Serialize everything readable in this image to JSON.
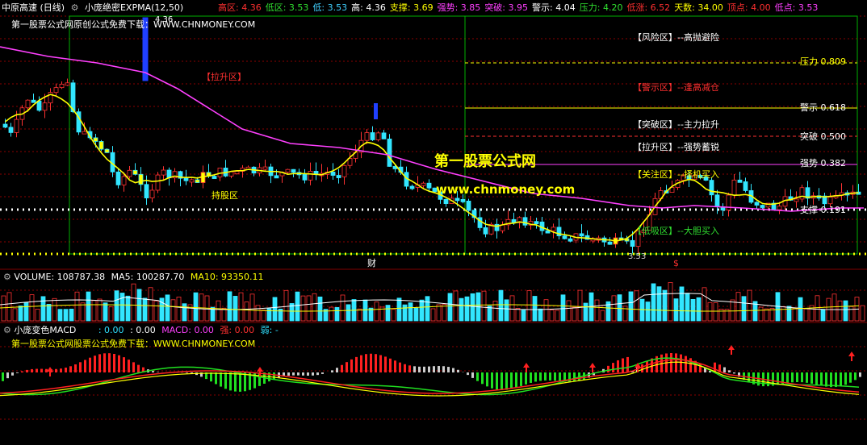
{
  "colors": {
    "up": "#ff3232",
    "down": "#32e6ff",
    "ma": "#ffff00",
    "expma": "#ff40ff",
    "grid": "#8b0000",
    "frame": "#00b000",
    "white": "#ffffff"
  },
  "header": {
    "stock": "中原高速 (日线)",
    "indicator": "小庞绝密EXPMA(12,50)",
    "items": [
      {
        "label": "高区:",
        "value": "4.36",
        "color": "#ff3030"
      },
      {
        "label": "低区:",
        "value": "3.53",
        "color": "#30e030"
      },
      {
        "label": "低:",
        "value": "3.53",
        "color": "#40d0ff"
      },
      {
        "label": "高:",
        "value": "4.36",
        "color": "#ffffff"
      },
      {
        "label": "支撑:",
        "value": "3.69",
        "color": "#ffff00"
      },
      {
        "label": "强势:",
        "value": "3.85",
        "color": "#ff40ff"
      },
      {
        "label": "突破:",
        "value": "3.95",
        "color": "#ff40ff"
      },
      {
        "label": "警示:",
        "value": "4.04",
        "color": "#ffffff"
      },
      {
        "label": "压力:",
        "value": "4.20",
        "color": "#30e030"
      },
      {
        "label": "低涨:",
        "value": "6.52",
        "color": "#ff3030"
      },
      {
        "label": "天数:",
        "value": "34.00",
        "color": "#ffff00"
      },
      {
        "label": "顶点:",
        "value": "4.00",
        "color": "#ff3030"
      },
      {
        "label": "低点:",
        "value": "3.53",
        "color": "#ff40ff"
      }
    ]
  },
  "main": {
    "banner": "第一股票公式网原创公式免费下载：WWW.CHNMONEY.COM",
    "high_mark": "4.36",
    "low_mark": "3.53",
    "zone_lift": "【拉升区】",
    "zone_hold": "持股区",
    "zones": [
      {
        "tag": "【风险区】",
        "desc": "--高抛避险",
        "tagcolor": "#ffffff",
        "desccolor": "#ffffff"
      },
      {
        "tag": "【警示区】",
        "desc": "--逢高减仓",
        "tagcolor": "#ff3030",
        "desccolor": "#ff3030"
      },
      {
        "tag": "【突破区】",
        "desc": "--主力拉升",
        "tagcolor": "#ffffff",
        "desccolor": "#ffffff"
      },
      {
        "tag": "【拉升区】",
        "desc": "--强势蓄锐",
        "tagcolor": "#ffffff",
        "desccolor": "#ffffff"
      },
      {
        "tag": "【关注区】",
        "desc": "--择机买入",
        "tagcolor": "#ffff00",
        "desccolor": "#ffff00"
      },
      {
        "tag": "【低吸区】",
        "desc": "--大胆买入",
        "tagcolor": "#30e030",
        "desccolor": "#30e030"
      }
    ],
    "levels": [
      {
        "label": "压力 0.809",
        "color": "#ffff00"
      },
      {
        "label": "警示 0.618",
        "color": "#ffffff"
      },
      {
        "label": "突破 0.500",
        "color": "#ffffff"
      },
      {
        "label": "强势 0.382",
        "color": "#ffffff"
      },
      {
        "label": "支撑 0.191",
        "color": "#ffffff"
      }
    ],
    "watermark_name": "第一股票公式网",
    "watermark_url": "www.chnmoney.com",
    "marker_cai": "财",
    "marker_dollar": "$"
  },
  "volume": {
    "label": "VOLUME: 108787.38",
    "ma5": "MA5: 100287.70",
    "ma10": "MA10: 93350.11"
  },
  "macd": {
    "name": "小庞变色MACD",
    "v1": ": 0.00",
    "v2": ": 0.00",
    "macd": "MACD: 0.00",
    "strong": "强: 0.00",
    "weak": "弱: -",
    "banner": "第一股票公式网股票公式免费下载：WWW.CHNMONEY.COM"
  }
}
